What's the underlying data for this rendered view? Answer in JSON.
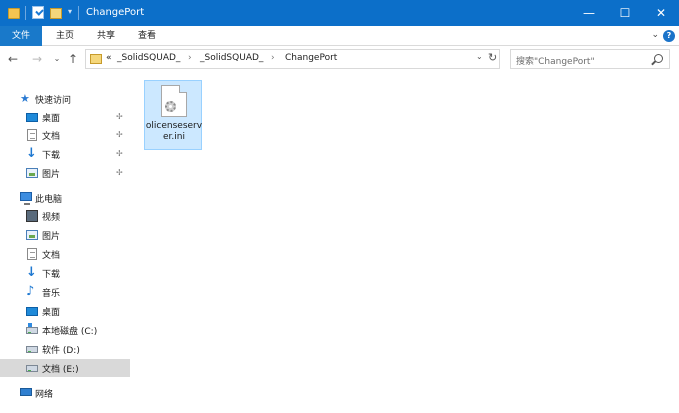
{
  "window": {
    "title": "ChangePort",
    "controls": {
      "minimize": "—",
      "maximize": "☐",
      "close": "✕"
    }
  },
  "ribbon": {
    "tabs": [
      {
        "label": "文件",
        "active": true
      },
      {
        "label": "主页",
        "active": false
      },
      {
        "label": "共享",
        "active": false
      },
      {
        "label": "查看",
        "active": false
      }
    ],
    "expand_icon": "chevron-down-icon",
    "help": "?"
  },
  "address": {
    "overflow": "«",
    "breadcrumbs": [
      "_SolidSQUAD_",
      "_SolidSQUAD_",
      "ChangePort"
    ],
    "separator": "›",
    "dropdown": "⌄",
    "refresh": "↻"
  },
  "search": {
    "placeholder": "搜索\"ChangePort\""
  },
  "nav": {
    "quick_access": {
      "label": "快速访问",
      "items": [
        {
          "label": "桌面",
          "icon": "desktop-icon",
          "pinned": true
        },
        {
          "label": "文档",
          "icon": "document-icon",
          "pinned": true
        },
        {
          "label": "下载",
          "icon": "download-icon",
          "pinned": true
        },
        {
          "label": "图片",
          "icon": "picture-icon",
          "pinned": true
        }
      ]
    },
    "this_pc": {
      "label": "此电脑",
      "items": [
        {
          "label": "视频",
          "icon": "video-icon"
        },
        {
          "label": "图片",
          "icon": "picture-icon"
        },
        {
          "label": "文档",
          "icon": "document-icon"
        },
        {
          "label": "下载",
          "icon": "download-icon"
        },
        {
          "label": "音乐",
          "icon": "music-icon"
        },
        {
          "label": "桌面",
          "icon": "desktop-icon"
        },
        {
          "label": "本地磁盘 (C:)",
          "icon": "drive-icon"
        },
        {
          "label": "软件 (D:)",
          "icon": "drive-icon"
        },
        {
          "label": "文档 (E:)",
          "icon": "drive-icon",
          "selected": true
        }
      ]
    },
    "network": {
      "label": "网络",
      "icon": "network-icon"
    }
  },
  "files": [
    {
      "name": "olicenseserver.ini",
      "display": "olicenseserver.ini",
      "icon": "config-file-icon",
      "selected": true
    }
  ],
  "colors": {
    "titlebar": "#0c6fc9",
    "active_tab": "#1979ca",
    "selection": "#cce8ff",
    "nav_selected": "#d9d9d9"
  }
}
